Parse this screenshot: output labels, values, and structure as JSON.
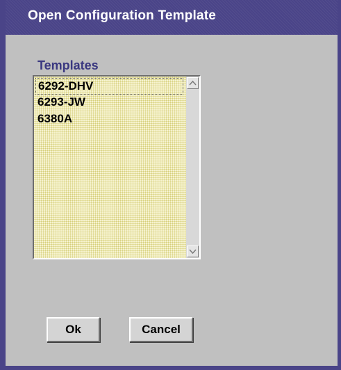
{
  "window": {
    "title": "Open Configuration Template"
  },
  "templates": {
    "label": "Templates",
    "items": [
      "6292-DHV",
      "6293-JW",
      "6380A"
    ],
    "selected_index": 0
  },
  "buttons": {
    "ok": "Ok",
    "cancel": "Cancel"
  },
  "icons": {
    "scroll_up": "chevron-up-icon",
    "scroll_down": "chevron-down-icon"
  },
  "colors": {
    "title_bar": "#4a4488",
    "label_text": "#3a3880",
    "list_background": "#f6f3d0",
    "dialog_background": "#c0c0c0"
  }
}
